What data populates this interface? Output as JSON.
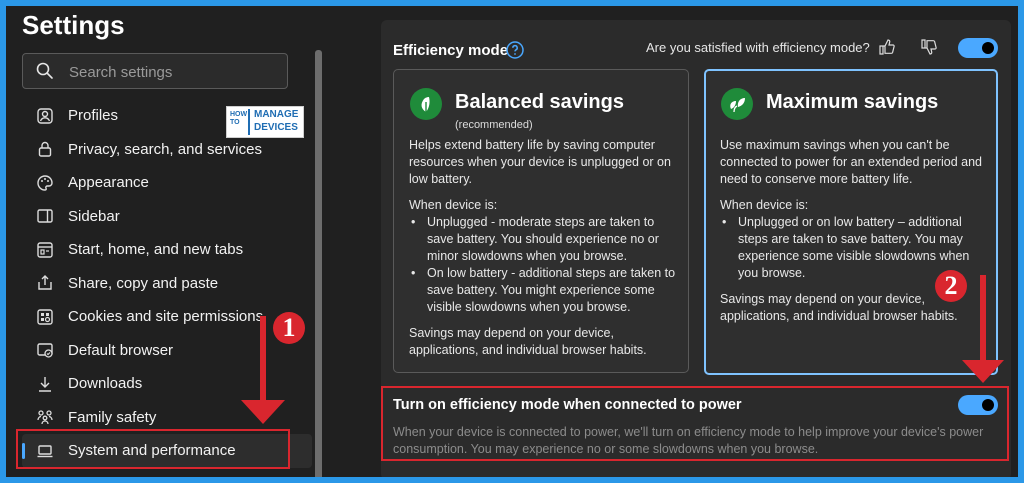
{
  "sidebar": {
    "title": "Settings",
    "search_placeholder": "Search settings",
    "items": [
      {
        "label": "Profiles",
        "icon": "profile-icon"
      },
      {
        "label": "Privacy, search, and services",
        "icon": "lock-icon"
      },
      {
        "label": "Appearance",
        "icon": "palette-icon"
      },
      {
        "label": "Sidebar",
        "icon": "sidebar-icon"
      },
      {
        "label": "Start, home, and new tabs",
        "icon": "home-tabs-icon"
      },
      {
        "label": "Share, copy and paste",
        "icon": "share-icon"
      },
      {
        "label": "Cookies and site permissions",
        "icon": "cookies-icon"
      },
      {
        "label": "Default browser",
        "icon": "browser-icon"
      },
      {
        "label": "Downloads",
        "icon": "download-icon"
      },
      {
        "label": "Family safety",
        "icon": "family-icon"
      },
      {
        "label": "System and performance",
        "icon": "laptop-icon",
        "active": true
      }
    ]
  },
  "logo": {
    "how": "HOW",
    "to": "TO",
    "manage": "MANAGE",
    "devices": "DEVICES"
  },
  "efficiency": {
    "title": "Efficiency mode",
    "feedback_question": "Are you satisfied with efficiency mode?",
    "toggle_on": true
  },
  "balanced": {
    "title": "Balanced savings",
    "subtitle": "(recommended)",
    "description": "Helps extend battery life by saving computer resources when your device is unplugged or on low battery.",
    "when_label": "When device is:",
    "bullets": [
      "Unplugged - moderate steps are taken to save battery. You should experience no or minor slowdowns when you browse.",
      "On low battery - additional steps are taken to save battery. You might experience some visible slowdowns when you browse."
    ],
    "footer": "Savings may depend on your device, applications, and individual browser habits."
  },
  "maximum": {
    "title": "Maximum savings",
    "description": "Use maximum savings when you can't be connected to power for an extended period and need to conserve more battery life.",
    "when_label": "When device is:",
    "bullets": [
      "Unplugged or on low battery – additional steps are taken to save battery. You may experience some visible slowdowns when you browse."
    ],
    "footer": "Savings may depend on your device, applications, and individual browser habits.",
    "selected": true
  },
  "power": {
    "title": "Turn on efficiency mode when connected to power",
    "description": "When your device is connected to power, we'll turn on efficiency mode to help improve your device's power consumption. You may experience no or some slowdowns when you browse.",
    "toggle_on": true
  },
  "annotations": {
    "badge_1": "1",
    "badge_2": "2"
  },
  "colors": {
    "accent": "#4aa8ff",
    "annotation_red": "#d9262e",
    "background": "#202020"
  }
}
